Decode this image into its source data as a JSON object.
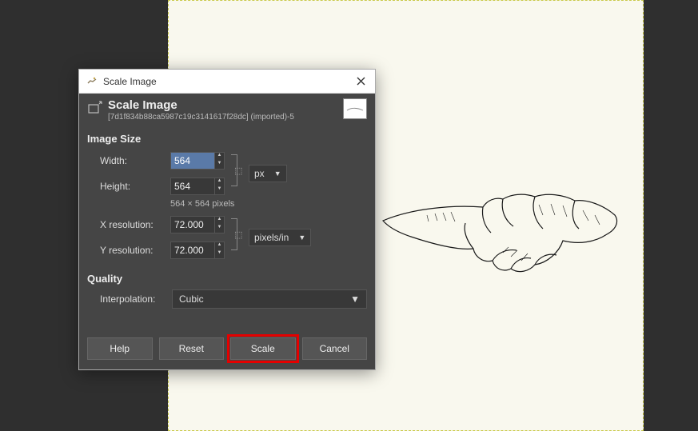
{
  "titlebar": {
    "text": "Scale Image"
  },
  "header": {
    "title": "Scale Image",
    "subtitle": "[7d1f834b88ca5987c19c3141617f28dc] (imported)-5"
  },
  "sections": {
    "imageSize": "Image Size",
    "quality": "Quality"
  },
  "fields": {
    "widthLabel": "Width:",
    "widthValue": "564",
    "heightLabel": "Height:",
    "heightValue": "564",
    "dimText": "564 × 564 pixels",
    "xresLabel": "X resolution:",
    "xresValue": "72.000",
    "yresLabel": "Y resolution:",
    "yresValue": "72.000",
    "sizeUnit": "px",
    "resUnit": "pixels/in",
    "interpLabel": "Interpolation:",
    "interpValue": "Cubic"
  },
  "buttons": {
    "help": "Help",
    "reset": "Reset",
    "scale": "Scale",
    "cancel": "Cancel"
  }
}
